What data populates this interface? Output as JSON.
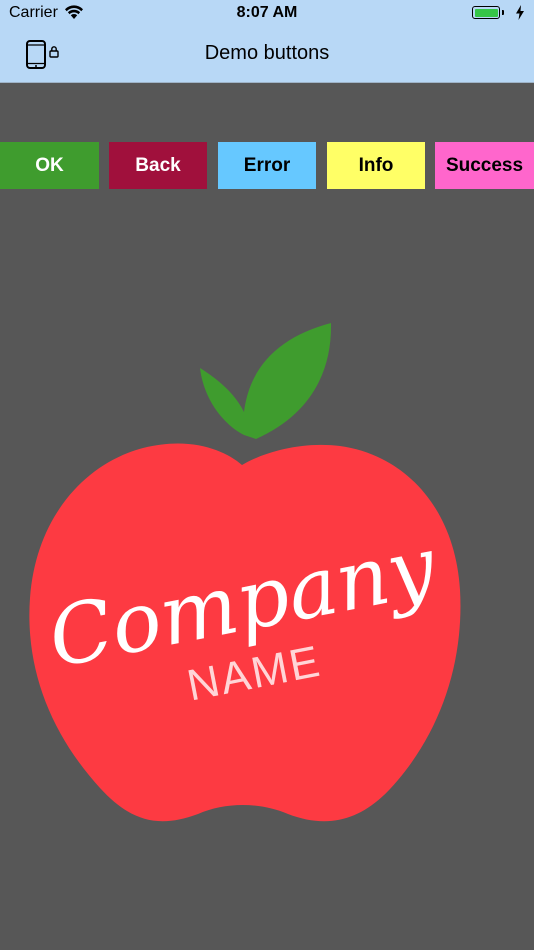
{
  "status_bar": {
    "carrier": "Carrier",
    "time": "8:07 AM",
    "wifi_icon": "wifi-icon",
    "battery_icon": "battery-icon",
    "charging_icon": "bolt-icon",
    "battery_color": "#36c648"
  },
  "nav_bar": {
    "title": "Demo buttons",
    "left_icon": "phone-lock-icon",
    "background": "#b8d8f6"
  },
  "buttons": [
    {
      "label": "OK",
      "background": "#3f9c2e",
      "color": "#ffffff"
    },
    {
      "label": "Back",
      "background": "#a0103c",
      "color": "#ffffff"
    },
    {
      "label": "Error",
      "background": "#66c8ff",
      "color": "#000000"
    },
    {
      "label": "Info",
      "background": "#ffff66",
      "color": "#000000"
    },
    {
      "label": "Success",
      "background": "#ff66cc",
      "color": "#000000"
    }
  ],
  "logo": {
    "word1": "Company",
    "word2": "NAME",
    "apple_color": "#fd3a42",
    "leaf_color": "#3f9c2e"
  },
  "page_background": "#575757"
}
